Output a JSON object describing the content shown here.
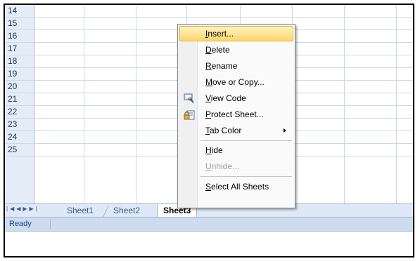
{
  "rows": [
    "14",
    "15",
    "16",
    "17",
    "18",
    "19",
    "20",
    "21",
    "22",
    "23",
    "24",
    "25"
  ],
  "sheet_tabs": [
    {
      "label": "Sheet1",
      "active": false
    },
    {
      "label": "Sheet2",
      "active": false
    },
    {
      "label": "Sheet3",
      "active": true
    }
  ],
  "status_text": "Ready",
  "context_menu": [
    {
      "label": "Insert...",
      "accel": "I",
      "rest": "nsert...",
      "highlighted": true
    },
    {
      "label": "Delete",
      "accel": "D",
      "rest": "elete"
    },
    {
      "label": "Rename",
      "accel": "R",
      "rest": "ename"
    },
    {
      "label": "Move or Copy...",
      "accel": "M",
      "rest": "ove or Copy..."
    },
    {
      "label": "View Code",
      "accel": "V",
      "rest": "iew Code",
      "icon": "view-code-icon"
    },
    {
      "label": "Protect Sheet...",
      "accel": "P",
      "rest": "rotect Sheet...",
      "icon": "protect-sheet-icon"
    },
    {
      "label": "Tab Color",
      "accel": "T",
      "rest": "ab Color",
      "submenu": true
    },
    {
      "label": "Hide",
      "accel": "H",
      "rest": "ide"
    },
    {
      "label": "Unhide...",
      "accel": "U",
      "rest": "nhide...",
      "disabled": true
    },
    {
      "label": "Select All Sheets",
      "accel": "S",
      "rest": "elect All Sheets"
    }
  ]
}
